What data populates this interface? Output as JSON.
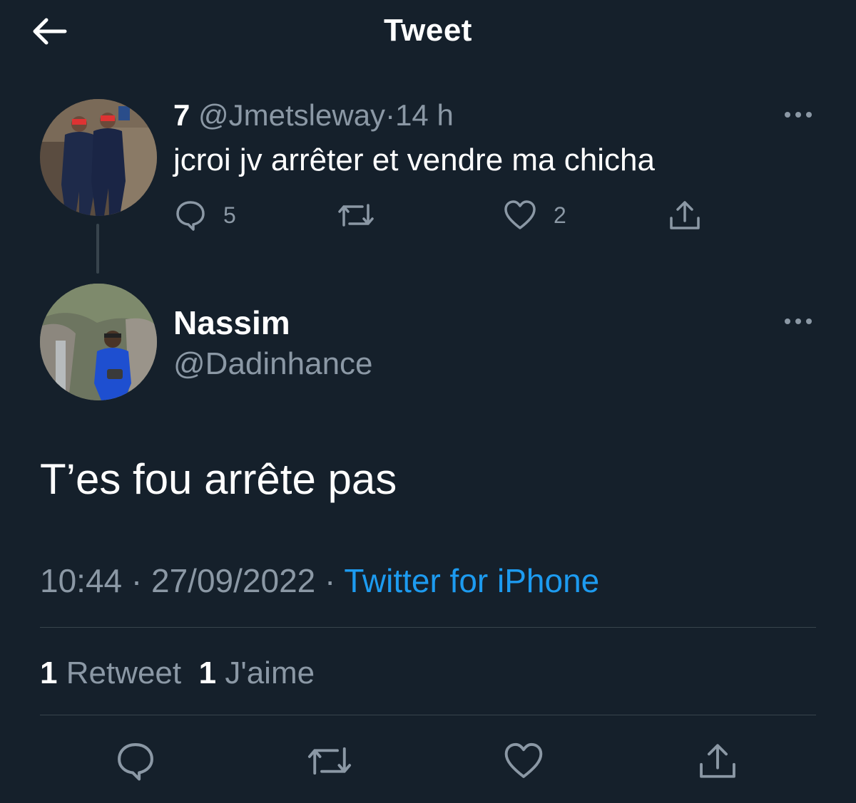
{
  "header": {
    "title": "Tweet",
    "back_icon": "arrow-left-icon"
  },
  "parent_tweet": {
    "display_name": "7",
    "handle": "@Jmetsleway",
    "separator": "·",
    "time_ago": "14 h",
    "text": "jcroi jv arrêter et vendre ma chicha",
    "actions": {
      "reply_count": "5",
      "retweet_count": "",
      "like_count": "2"
    }
  },
  "reply_tweet": {
    "display_name": "Nassim",
    "handle": "@Dadinhance",
    "text": "T’es fou arrête pas",
    "time": "10:44",
    "date": "27/09/2022",
    "separator": "·",
    "source": "Twitter for iPhone",
    "retweets_count": "1",
    "retweets_label": "Retweet",
    "likes_count": "1",
    "likes_label": "J'aime"
  },
  "colors": {
    "background": "#15202b",
    "text_primary": "#ffffff",
    "text_secondary": "#8b98a5",
    "accent": "#1d9bf0",
    "divider": "#38444d"
  },
  "icons": {
    "reply": "speech-bubble-icon",
    "retweet": "retweet-icon",
    "like": "heart-icon",
    "share": "share-upload-icon",
    "more": "more-horizontal-icon"
  }
}
